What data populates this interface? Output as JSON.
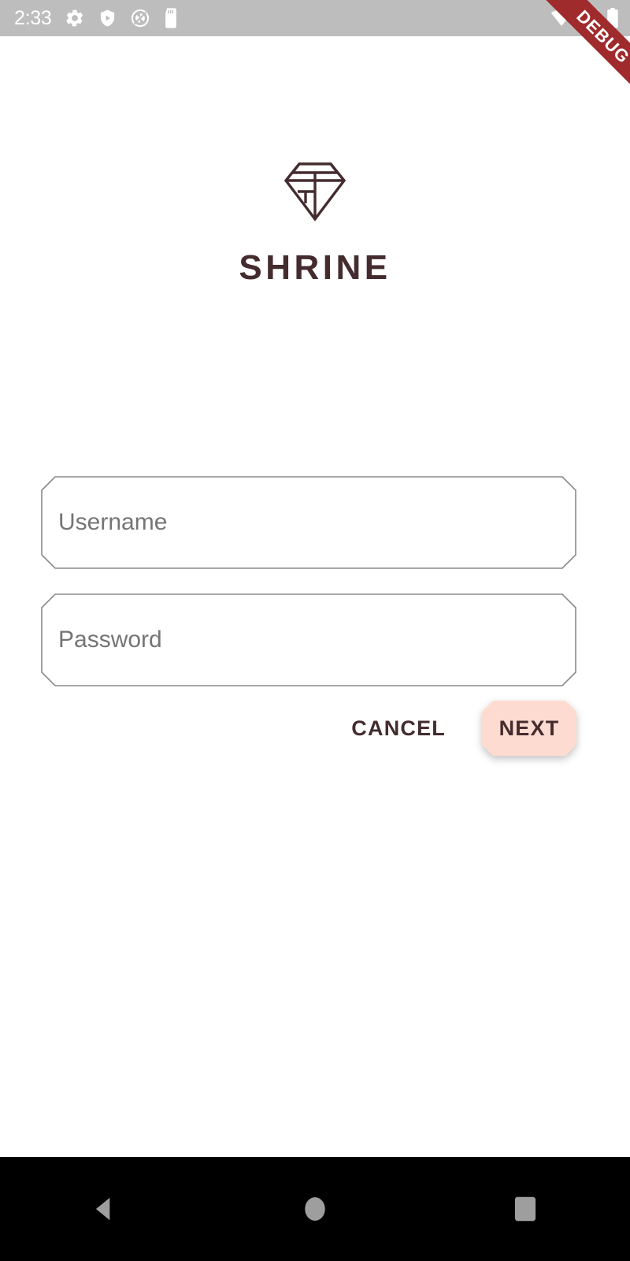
{
  "status_bar": {
    "clock": "2:33",
    "background_color": "#BDBDBD",
    "icon_color": "#FFFFFF",
    "left_icons": [
      {
        "name": "gear-icon",
        "label": "Settings"
      },
      {
        "name": "shield-play-icon",
        "label": "Play Protect"
      },
      {
        "name": "do-not-disturb-icon",
        "label": "Do Not Disturb"
      },
      {
        "name": "sd-card-icon",
        "label": "SD Card"
      }
    ],
    "right_icons": [
      {
        "name": "wifi-icon",
        "label": "Wi-Fi"
      },
      {
        "name": "cell-signal-off-icon",
        "label": "No Signal"
      },
      {
        "name": "battery-icon",
        "label": "Battery Full"
      }
    ]
  },
  "debug_ribbon": {
    "label": "DEBUG",
    "color": "#A02B2C",
    "text_color": "#FFFFFF"
  },
  "brand": {
    "logo_icon": "shrine-diamond-logo-icon",
    "title": "SHRINE",
    "color": "#442C2E"
  },
  "form": {
    "fields": [
      {
        "name": "username-input",
        "placeholder": "Username",
        "value": "",
        "type": "text"
      },
      {
        "name": "password-input",
        "placeholder": "Password",
        "value": "",
        "type": "password"
      }
    ],
    "border_color": "#8A8A8A",
    "placeholder_color": "#757575"
  },
  "actions": {
    "cancel_label": "CANCEL",
    "next_label": "NEXT",
    "next_background": "#FEDBD0",
    "text_color": "#442C2E"
  },
  "nav_bar": {
    "background_color": "#000000",
    "icon_color": "#9E9E9E",
    "buttons": [
      {
        "name": "nav-back-button",
        "label": "Back"
      },
      {
        "name": "nav-home-button",
        "label": "Home"
      },
      {
        "name": "nav-recents-button",
        "label": "Recents"
      }
    ]
  }
}
